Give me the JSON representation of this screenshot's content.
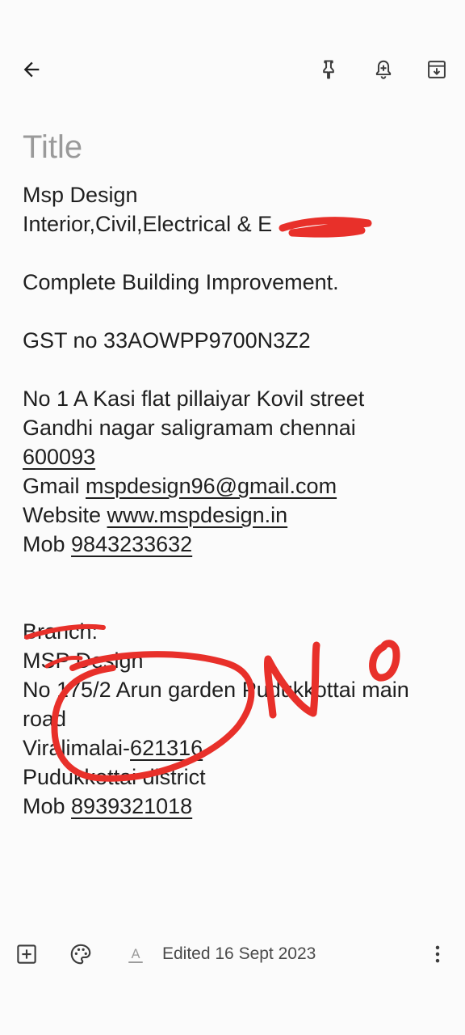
{
  "toolbar": {
    "back_icon": "arrow-back-icon",
    "pin_icon": "pin-icon",
    "reminder_icon": "bell-add-icon",
    "archive_icon": "archive-icon"
  },
  "note": {
    "title_placeholder": "Title",
    "lines": [
      "Msp Design",
      "Interior,Civil,Electrical & E",
      "",
      "Complete Building Improvement.",
      "",
      "GST no 33AOWPP9700N3Z2",
      "",
      "No 1 A Kasi flat pillaiyar Kovil street",
      "Gandhi nagar saligramam chennai",
      "600093",
      "Gmail ",
      "mspdesign96@gmail.com",
      "Website ",
      "www.mspdesign.in",
      "Mob ",
      "9843233632",
      "",
      "",
      "Branch:",
      "MSP Design",
      "No 175/2 Arun garden Pudukkottai main",
      "road",
      "Viralimalai-",
      "621316",
      "Pudukkottai district",
      "Mob ",
      "8939321018"
    ]
  },
  "annotation": {
    "handwritten_text": "No",
    "color": "#e8302a"
  },
  "bottom_bar": {
    "add_icon": "add-box-icon",
    "palette_icon": "palette-icon",
    "format_icon": "text-format-icon",
    "format_glyph": "A",
    "edited_label": "Edited 16 Sept 2023",
    "more_icon": "more-vert-icon"
  }
}
